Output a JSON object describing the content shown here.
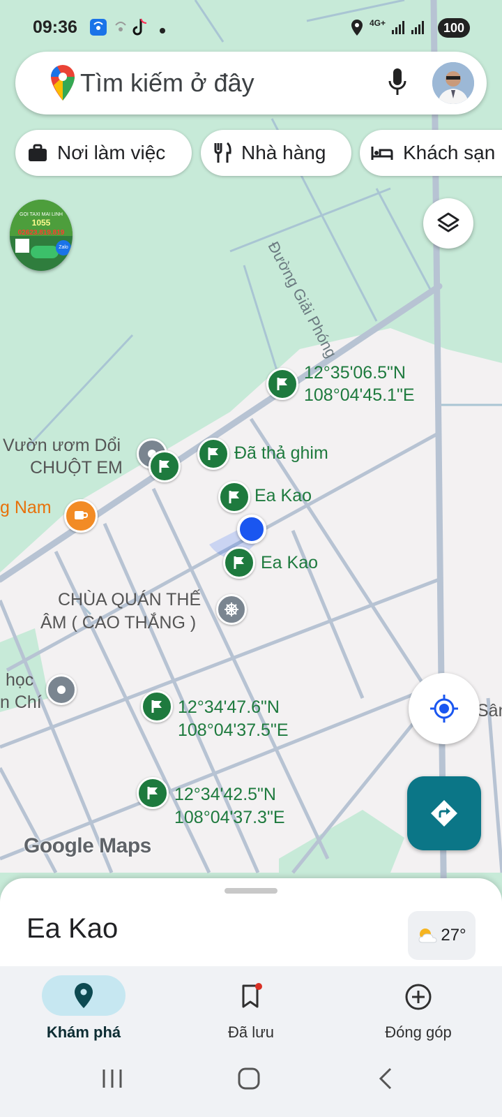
{
  "status_bar": {
    "time": "09:36",
    "network": "4G+",
    "battery": "100"
  },
  "search": {
    "placeholder": "Tìm kiếm ở đây"
  },
  "chips": [
    {
      "label": "Nơi làm việc",
      "icon": "briefcase-icon"
    },
    {
      "label": "Nhà hàng",
      "icon": "restaurant-icon"
    },
    {
      "label": "Khách sạn",
      "icon": "hotel-icon"
    }
  ],
  "ad_badge": {
    "line1": "GỌI TAXI MAI LINH",
    "number": "1055",
    "phone": "02623.819.819",
    "app": "Zalo"
  },
  "map": {
    "road_label": "Đường Giải Phóng",
    "coord_pin_1": {
      "lat": "12°35'06.5\"N",
      "lng": "108°04'45.1\"E"
    },
    "dropped_pin": "Đã thả ghim",
    "ea_kao_1": "Ea Kao",
    "ea_kao_2": "Ea Kao",
    "nursery_line1": "Vườn ươm Dổi",
    "nursery_line2": "CHUỘT EM",
    "cafe_label": "g Nam",
    "temple_line1": "CHÙA QUÁN THẾ",
    "temple_line2": "ÂM ( CAO THẮNG )",
    "school_line1": "học",
    "school_line2": "n Chí",
    "coord_pin_2": {
      "lat": "12°34'47.6\"N",
      "lng": "108°04'37.5\"E"
    },
    "coord_pin_3": {
      "lat": "12°34'42.5\"N",
      "lng": "108°04'37.3\"E"
    },
    "edge_label": "Sân",
    "watermark": "Google Maps"
  },
  "sheet": {
    "title": "Ea Kao",
    "temperature": "27°"
  },
  "bottom_nav": [
    {
      "label": "Khám phá",
      "active": true
    },
    {
      "label": "Đã lưu",
      "active": false
    },
    {
      "label": "Đóng góp",
      "active": false
    }
  ],
  "colors": {
    "accent": "#0b7687",
    "pin_green": "#1e7a3e",
    "blue_dot": "#1a56f0",
    "park": "#c7ead8",
    "urban": "#f3f1f2"
  }
}
